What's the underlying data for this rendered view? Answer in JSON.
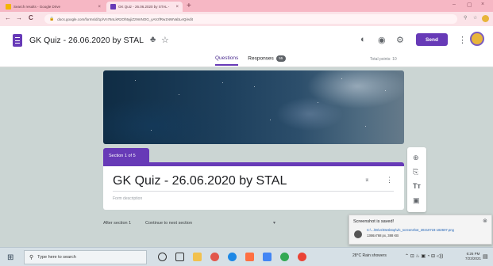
{
  "browser": {
    "tabs": [
      {
        "label": "Search results - Google Drive",
        "icon": "drive-icon",
        "close": "×"
      },
      {
        "label": "GK Quiz - 26.06.2020 by STAL - ",
        "icon": "forms-icon",
        "close": "×"
      }
    ],
    "new_tab": "+",
    "window_controls": {
      "minimize": "–",
      "maximize": "▢",
      "close": "×"
    },
    "nav": {
      "back": "←",
      "forward": "→",
      "reload": "C"
    },
    "url": "docs.google.com/forms/d/1p/Vn76nLkR2Oh5yjiZz9mNOG_yAVzfRw1NWVabLeQ/edit"
  },
  "form_header": {
    "title": "GK Quiz - 26.06.2020 by STAL",
    "send_label": "Send",
    "tabs": [
      {
        "label": "Questions",
        "active": true
      },
      {
        "label": "Responses",
        "badge": "55",
        "active": false
      }
    ],
    "total_points": "Total points: 10"
  },
  "section": {
    "tag": "Section 1 of 5",
    "title": "GK Quiz - 26.06.2020 by STAL",
    "description_placeholder": "Form description"
  },
  "after_section": {
    "label": "After section 1",
    "selected": "Continue to next section"
  },
  "toast": {
    "title": "Screenshot is saved!",
    "path": "C:\\...\\Drive\\Desktop\\vlc_screenshot_20210723-182607.png",
    "size": "1366x768 px, 388 KB"
  },
  "taskbar": {
    "search_placeholder": "Type here to search",
    "weather": "28°C  Rain showers",
    "time": "6:26 PM",
    "date": "7/23/2021"
  },
  "colors": {
    "accent": "#673ab7",
    "background": "#cbd5d3",
    "tab_strip": "#f6b7c4"
  }
}
